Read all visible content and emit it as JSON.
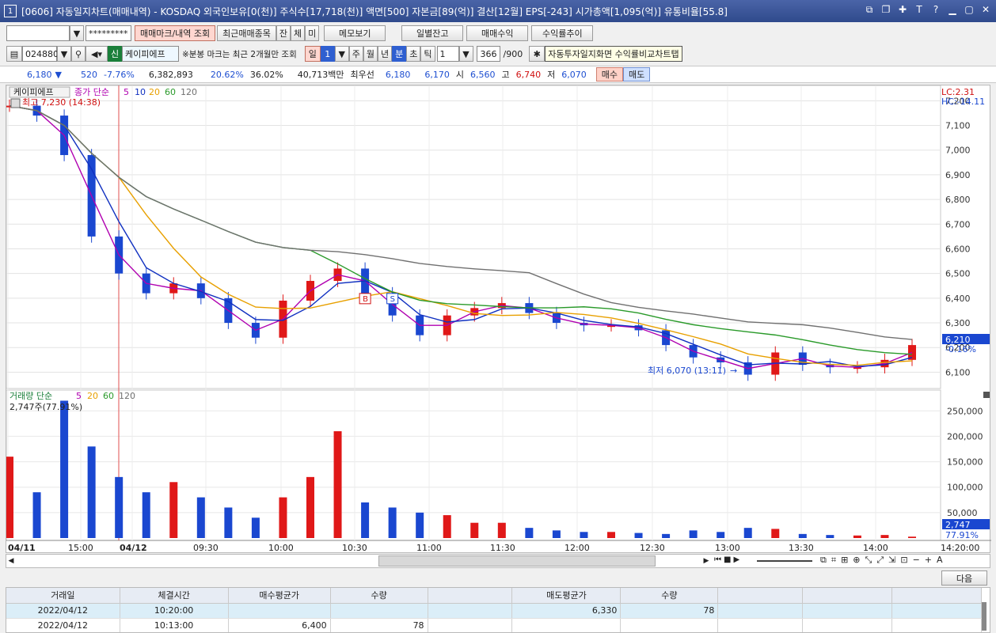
{
  "window": {
    "badge": "1",
    "title": "[0606] 자동일지차트(매매내역) - KOSDAQ 외국인보유[0(천)] 주식수[17,718(천)] 액면[500] 자본금[89(억)] 결산[12월] EPS[-243] 시가총액[1,095(억)] 유통비율[55.8]"
  },
  "toolbar1": {
    "account": "",
    "password": "*********",
    "btn_mark": "매매마크/내역 조회",
    "btn_recent": "최근매매종목",
    "btn_jan": "잔",
    "btn_che": "체",
    "btn_mi": "미",
    "btn_memo": "메모보기",
    "btn_daily": "일별잔고",
    "btn_profit": "매매수익",
    "btn_profit_trend": "수익률추이"
  },
  "toolbar2": {
    "code": "024880",
    "name_badge": "신",
    "name": "케이피에프",
    "note": "※분봉 마크는 최근 2개월만 조회",
    "period_il": "일",
    "period_n": "1",
    "ju": "주",
    "wol": "월",
    "nyeon": "년",
    "bun": "분",
    "cho": "초",
    "tik": "틱",
    "interval": "1",
    "count": "366",
    "count_max": "/900",
    "tooltip": "자동투자일지화면 수익률비교차트탭"
  },
  "quote": {
    "price": "6,180",
    "arrow": "▼",
    "change": "520",
    "rate": "-7.76%",
    "volume": "6,382,893",
    "turnover_rate": "20.62%",
    "ratio2": "36.02%",
    "amount": "40,713백만",
    "best_label": "최우선",
    "ask": "6,180",
    "bid": "6,170",
    "open_label": "시",
    "open": "6,560",
    "high_label": "고",
    "high": "6,740",
    "low_label": "저",
    "low": "6,070",
    "buy_btn": "매수",
    "sell_btn": "매도"
  },
  "chart": {
    "name_tag": "케이피에프",
    "ma_legend_label": "종가 단순",
    "ma_periods": [
      "5",
      "10",
      "20",
      "60",
      "120"
    ],
    "ma_colors": [
      "#b000b0",
      "#1030c0",
      "#e8a000",
      "#2a9a2a",
      "#707070"
    ],
    "high_note": "최고 7,230 (14:38)",
    "low_note": "최저 6,070 (13:11)",
    "lc": "LC:2.31",
    "hc": "HC:-14.11",
    "price_ticks": [
      "7,200",
      "7,100",
      "7,000",
      "6,900",
      "6,800",
      "6,700",
      "6,600",
      "6,500",
      "6,400",
      "6,300",
      "6,200",
      "6,100"
    ],
    "last_price": "6,210",
    "last_rate": "-0.16%",
    "vol_legend_label": "거래량 단순",
    "vol_ma_periods": [
      "5",
      "20",
      "60",
      "120"
    ],
    "vol_note": "2,747주(77.91%)",
    "vol_ticks": [
      "250,000",
      "200,000",
      "150,000",
      "100,000",
      "50,000"
    ],
    "vol_last": "2,747",
    "vol_last_rate": "77.91%",
    "time_labels": [
      "04/11",
      "15:00",
      "04/12",
      "09:30",
      "10:00",
      "10:30",
      "11:00",
      "11:30",
      "12:00",
      "12:30",
      "13:00",
      "13:30",
      "14:00",
      "14:20:00"
    ],
    "mark_b": "B",
    "mark_s": "S"
  },
  "chart_data": {
    "type": "candlestick",
    "x": [
      "04/11 14:38",
      "04/11 15:00",
      "04/12 09:00",
      "09:05",
      "09:10",
      "09:15",
      "09:20",
      "09:30",
      "09:40",
      "09:50",
      "10:00",
      "10:05",
      "10:10",
      "10:15",
      "10:20",
      "10:30",
      "10:40",
      "10:50",
      "11:00",
      "11:15",
      "11:30",
      "11:45",
      "12:00",
      "12:15",
      "12:30",
      "12:45",
      "13:00",
      "13:11",
      "13:20",
      "13:30",
      "13:45",
      "14:00",
      "14:10",
      "14:20"
    ],
    "close": [
      7180,
      7140,
      6980,
      6650,
      6500,
      6420,
      6460,
      6400,
      6300,
      6240,
      6390,
      6470,
      6520,
      6420,
      6330,
      6250,
      6330,
      6360,
      6380,
      6340,
      6300,
      6290,
      6290,
      6270,
      6210,
      6160,
      6140,
      6090,
      6180,
      6130,
      6120,
      6120,
      6150,
      6210
    ],
    "volume": [
      160000,
      90000,
      270000,
      180000,
      120000,
      90000,
      110000,
      80000,
      60000,
      40000,
      80000,
      120000,
      210000,
      70000,
      60000,
      50000,
      45000,
      30000,
      30000,
      20000,
      15000,
      12000,
      12000,
      10000,
      8000,
      15000,
      12000,
      20000,
      18000,
      8000,
      6000,
      5000,
      6000,
      2747
    ],
    "y_range": [
      6050,
      7230
    ],
    "volume_range": [
      0,
      280000
    ],
    "high": 7230,
    "low": 6070
  },
  "controls": {
    "next": "다음"
  },
  "table": {
    "headers": [
      "거래일",
      "체결시간",
      "매수평균가",
      "수량",
      "",
      "매도평균가",
      "수량",
      "",
      "",
      ""
    ],
    "rows": [
      [
        "2022/04/12",
        "10:20:00",
        "",
        "",
        "",
        "6,330",
        "78",
        "",
        "",
        ""
      ],
      [
        "2022/04/12",
        "10:13:00",
        "6,400",
        "78",
        "",
        "",
        "",
        "",
        "",
        ""
      ]
    ]
  }
}
